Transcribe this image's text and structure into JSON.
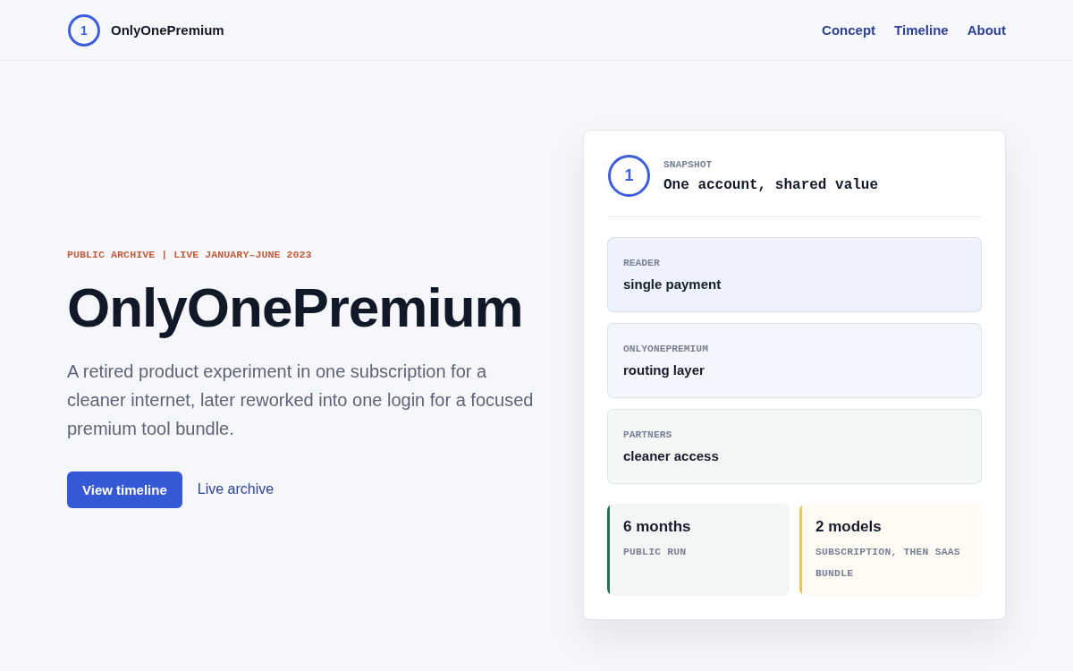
{
  "header": {
    "brand": {
      "mark": "1",
      "name": "OnlyOnePremium"
    },
    "nav": [
      "Concept",
      "Timeline",
      "About"
    ]
  },
  "hero": {
    "eyebrow": "PUBLIC ARCHIVE | LIVE JANUARY–JUNE 2023",
    "title": "OnlyOnePremium",
    "description": "A retired product experiment in one subscription for a cleaner internet, later reworked into one login for a focused premium tool bundle.",
    "actions": [
      {
        "label": "View timeline",
        "kind": "primary"
      },
      {
        "label": "Live archive",
        "kind": "link"
      }
    ]
  },
  "snapshot": {
    "mark": "1",
    "label": "SNAPSHOT",
    "title": "One account, shared value",
    "flow": [
      {
        "label": "READER",
        "value": "single payment",
        "color": "#eef2fd"
      },
      {
        "label": "ONLYONEPREMIUM",
        "value": "routing layer",
        "color": "#f4f6fd"
      },
      {
        "label": "PARTNERS",
        "value": "cleaner access",
        "color": "#f3f8f6"
      }
    ],
    "stats": [
      {
        "value": "6 months",
        "label": "PUBLIC RUN",
        "color": "#1f6f5a"
      },
      {
        "value": "2 models",
        "label": "SUBSCRIPTION, THEN SAAS BUNDLE",
        "color": "#e9c45a"
      }
    ]
  }
}
